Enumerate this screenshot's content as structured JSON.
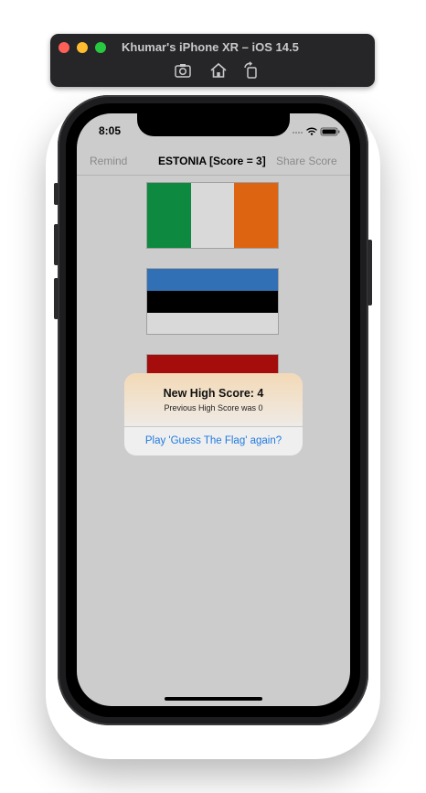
{
  "simulator": {
    "title": "Khumar's iPhone XR – iOS 14.5",
    "toolbar_icons": [
      "screenshot-icon",
      "home-icon",
      "rotate-icon"
    ]
  },
  "status_bar": {
    "time": "8:05"
  },
  "nav": {
    "left_button": "Remind",
    "title": "ESTONIA [Score = 3]",
    "right_button": "Share Score"
  },
  "flags": [
    {
      "name": "flag-ireland",
      "colors": [
        "#0d8a3f",
        "#d9d9d9",
        "#dd6410"
      ]
    },
    {
      "name": "flag-estonia",
      "colors": [
        "#3170b4",
        "#000000",
        "#d9d9d9"
      ]
    },
    {
      "name": "flag-partial",
      "colors": [
        "#a50d0d",
        "#e0a21a"
      ]
    }
  ],
  "alert": {
    "title": "New High Score:  4",
    "message": "Previous High Score was 0",
    "button": "Play 'Guess The Flag' again?"
  },
  "colors": {
    "screen_bg": "#cccccc",
    "accent": "#1f7ae0"
  }
}
